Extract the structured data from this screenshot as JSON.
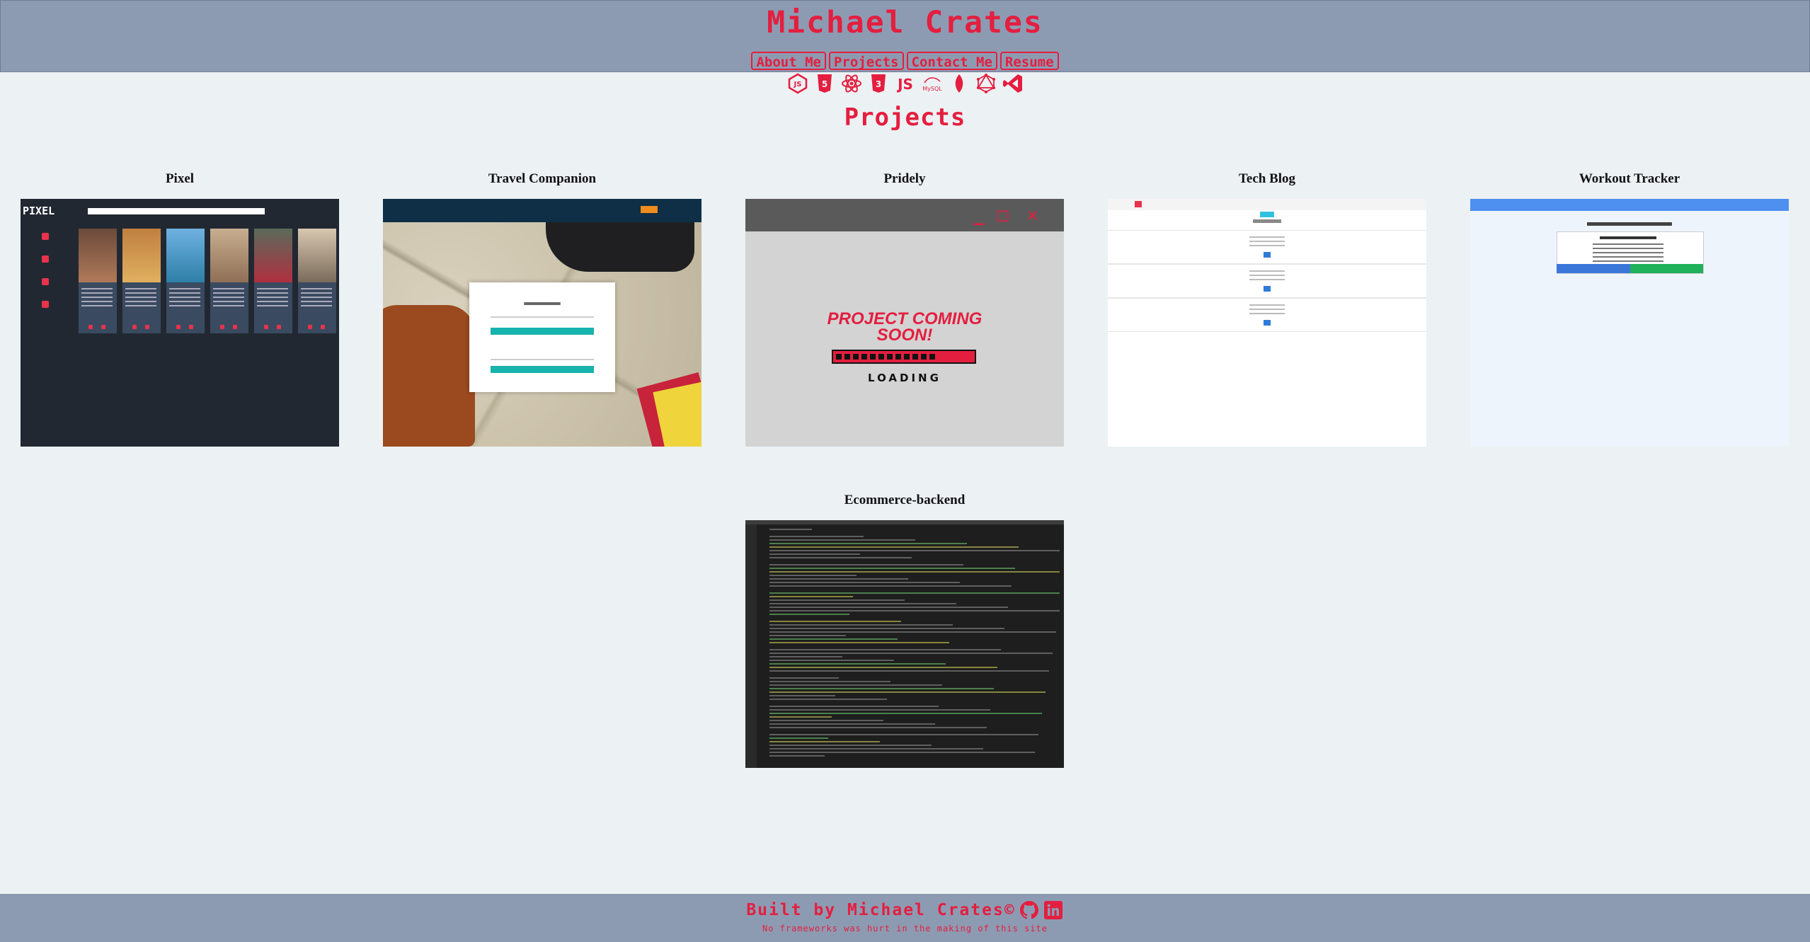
{
  "header": {
    "title": "Michael Crates",
    "nav": [
      "About Me",
      "Projects",
      "Contact Me",
      "Resume"
    ]
  },
  "tech_icons": [
    "nodejs-icon",
    "html5-icon",
    "react-icon",
    "css3-icon",
    "javascript-icon",
    "mysql-icon",
    "mongodb-icon",
    "graphql-icon",
    "vscode-icon"
  ],
  "tech_labels": {
    "js": "JS",
    "mysql": "MySQL"
  },
  "section": {
    "title": "Projects"
  },
  "projects": [
    {
      "title": "Pixel"
    },
    {
      "title": "Travel Companion"
    },
    {
      "title": "Pridely"
    },
    {
      "title": "Tech Blog"
    },
    {
      "title": "Workout Tracker"
    },
    {
      "title": "Ecommerce-backend"
    }
  ],
  "pixel_thumb": {
    "logo": "PIXEL"
  },
  "pridely_thumb": {
    "headline_1": "PROJECT COMING",
    "headline_2": "SOON!",
    "loading": "LOADING"
  },
  "footer": {
    "text": "Built by Michael Crates©",
    "tagline": "No frameworks was hurt in the making of this site"
  },
  "colors": {
    "accent": "#e41e3f",
    "header_bg": "#8d9bb2",
    "page_bg": "#ecf1f4"
  }
}
